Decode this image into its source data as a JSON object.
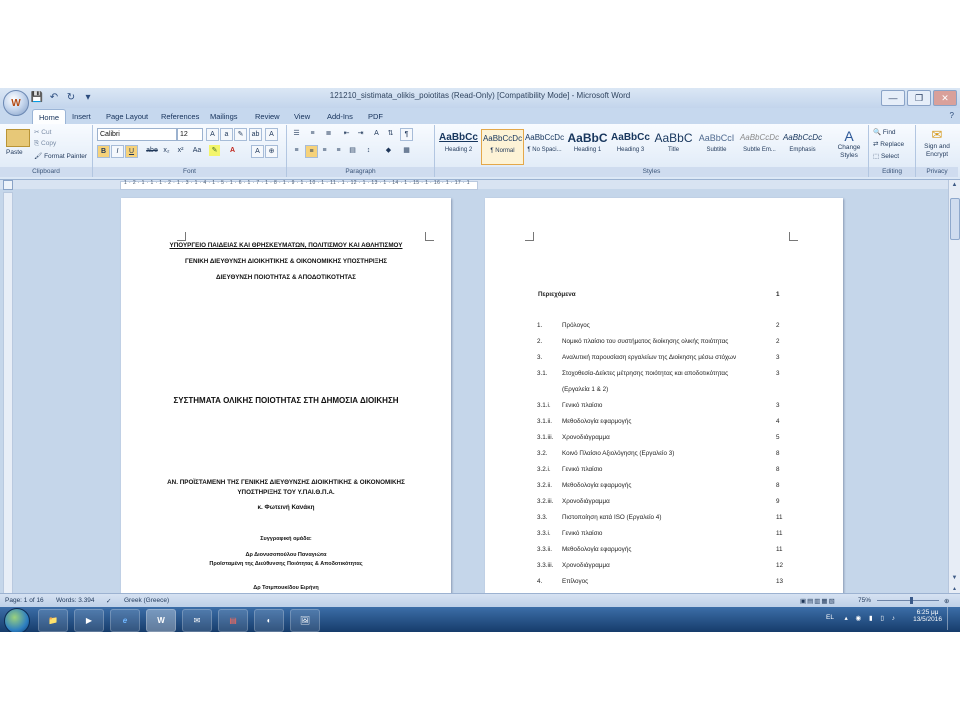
{
  "window": {
    "title": "121210_sistimata_olikis_poiotitas (Read-Only) [Compatibility Mode] - Microsoft Word",
    "office_button_glyph": "W",
    "controls": [
      "—",
      "❐",
      "✕"
    ]
  },
  "qat": {
    "items": [
      "💾",
      "↶",
      "↻",
      "▾"
    ]
  },
  "tabs": [
    {
      "label": "Home",
      "active": true
    },
    {
      "label": "Insert"
    },
    {
      "label": "Page Layout"
    },
    {
      "label": "References"
    },
    {
      "label": "Mailings"
    },
    {
      "label": "Review"
    },
    {
      "label": "View"
    },
    {
      "label": "Add-Ins"
    },
    {
      "label": "PDF"
    }
  ],
  "ribbon": {
    "clipboard": {
      "paste": "Paste",
      "cut": "Cut",
      "copy": "Copy",
      "format_painter": "Format Painter",
      "label": "Clipboard"
    },
    "font": {
      "name": "Calibri",
      "size": "12",
      "label": "Font",
      "buttons": [
        "B",
        "I",
        "U",
        "abe",
        "x₂",
        "x²",
        "Aa",
        "A"
      ]
    },
    "paragraph": {
      "label": "Paragraph"
    },
    "styles": {
      "label": "Styles",
      "items": [
        {
          "preview": "AaBbCc",
          "name": "Heading 2"
        },
        {
          "preview": "AaBbCcDc",
          "name": "¶ Normal",
          "selected": true
        },
        {
          "preview": "AaBbCcDc",
          "name": "¶ No Spaci..."
        },
        {
          "preview": "AaBbC",
          "name": "Heading 1"
        },
        {
          "preview": "AaBbCc",
          "name": "Heading 3"
        },
        {
          "preview": "AaBbC",
          "name": "Title"
        },
        {
          "preview": "AaBbCcI",
          "name": "Subtitle"
        },
        {
          "preview": "AaBbCcDc",
          "name": "Subtle Em..."
        },
        {
          "preview": "AaBbCcDc",
          "name": "Emphasis"
        }
      ],
      "change_styles": "Change Styles"
    },
    "editing": {
      "label": "Editing",
      "find": "Find",
      "replace": "Replace",
      "select": "Select"
    },
    "privacy": {
      "label": "Privacy",
      "sign": "Sign and Encrypt"
    }
  },
  "ruler": {
    "numbers": "1 · 2 · 1 · 1 · 1 · 2 · 1 · 3 · 1 · 4 · 1 · 5 · 1 · 6 · 1 · 7 · 1 · 8 · 1 · 9 · 1 · 10 · 1 · 11 · 1 · 12 · 1 · 13 · 1 · 14 · 1 · 15 · 1 · 16 · 1 · 17 · 1"
  },
  "page1": {
    "header1": "ΥΠΟΥΡΓΕΙΟ ΠΑΙΔΕΙΑΣ ΚΑΙ ΘΡΗΣΚΕΥΜΑΤΩΝ, ΠΟΛΙΤΙΣΜΟΥ ΚΑΙ ΑΘΛΗΤΙΣΜΟΥ",
    "header2": "ΓΕΝΙΚΗ ΔΙΕΥΘΥΝΣΗ ΔΙΟΙΚΗΤΙΚΗΣ & ΟΙΚΟΝΟΜΙΚΗΣ ΥΠΟΣΤΗΡΙΞΗΣ",
    "header3": "ΔΙΕΥΘΥΝΣΗ ΠΟΙΟΤΗΤΑΣ & ΑΠΟΔΟΤΙΚΟΤΗΤΑΣ",
    "title": "ΣΥΣΤΗΜΑΤΑ ΟΛΙΚΗΣ ΠΟΙΟΤΗΤΑΣ ΣΤΗ ΔΗΜΟΣΙΑ ΔΙΟΙΚΗΣΗ",
    "head_line1": "ΑΝ. ΠΡΟΪΣΤΑΜΕΝΗ ΤΗΣ ΓΕΝΙΚΗΣ ΔΙΕΥΘΥΝΣΗΣ ΔΙΟΙΚΗΤΙΚΗΣ & ΟΙΚΟΝΟΜΙΚΗΣ",
    "head_line2": "ΥΠΟΣΤΗΡΙΞΗΣ ΤΟΥ Υ.ΠΑΙ.Θ.Π.Α.",
    "head_name": "κ. Φωτεινή Κανάκη",
    "team_label": "Συγγραφική ομάδα:",
    "member1_name": "Δρ Διονυσοπούλου Παναγιώτα",
    "member1_role": "Προϊσταμένη της Διεύθυνσης Ποιότητας & Αποδοτικότητας",
    "member2_name": "Δρ Τσιμπουκίδου Ειρήνη"
  },
  "toc": {
    "heading": "Περιεχόμενα",
    "heading_page": "1",
    "rows": [
      {
        "n": "1.",
        "t": "Πρόλογος",
        "p": "2"
      },
      {
        "n": "2.",
        "t": "Νομικό πλαίσιο του συστήματος διοίκησης ολικής ποιότητας",
        "p": "2"
      },
      {
        "n": "3.",
        "t": "Αναλυτική παρουσίαση εργαλείων της Διοίκησης μέσω στόχων",
        "p": "3"
      },
      {
        "n": "3.1.",
        "t": "Στοχοθεσία-Δείκτες μέτρησης ποιότητας και αποδοτικότητας",
        "p": "3"
      },
      {
        "n": "",
        "t": "(Εργαλεία 1 & 2)",
        "p": ""
      },
      {
        "n": "3.1.i.",
        "t": "Γενικό πλαίσιο",
        "p": "3"
      },
      {
        "n": "3.1.ii.",
        "t": "Μεθοδολογία εφαρμογής",
        "p": "4"
      },
      {
        "n": "3.1.iii.",
        "t": "Χρονοδιάγραμμα",
        "p": "5"
      },
      {
        "n": "3.2.",
        "t": "Κοινό Πλαίσιο Αξιολόγησης (Εργαλείο 3)",
        "p": "8"
      },
      {
        "n": "3.2.i.",
        "t": "Γενικό πλαίσιο",
        "p": "8"
      },
      {
        "n": "3.2.ii.",
        "t": "Μεθοδολογία εφαρμογής",
        "p": "8"
      },
      {
        "n": "3.2.iii.",
        "t": "Χρονοδιάγραμμα",
        "p": "9"
      },
      {
        "n": "3.3.",
        "t": "Πιστοποίηση κατά ISO (Εργαλείο 4)",
        "p": "11"
      },
      {
        "n": "3.3.i.",
        "t": "Γενικό πλαίσιο",
        "p": "11"
      },
      {
        "n": "3.3.ii.",
        "t": "Μεθοδολογία εφαρμογής",
        "p": "11"
      },
      {
        "n": "3.3.iii.",
        "t": "Χρονοδιάγραμμα",
        "p": "12"
      },
      {
        "n": "4.",
        "t": "Επίλογος",
        "p": "13"
      }
    ]
  },
  "status": {
    "page": "Page: 1 of 16",
    "words": "Words: 3.394",
    "language": "Greek (Greece)",
    "zoom": "75%"
  },
  "taskbar": {
    "apps": [
      "📁",
      "▶",
      "e",
      "W",
      "✉",
      "▤",
      "◐",
      "🖼"
    ],
    "lang": "EL",
    "time": "6:25 μμ",
    "date": "13/5/2016"
  }
}
